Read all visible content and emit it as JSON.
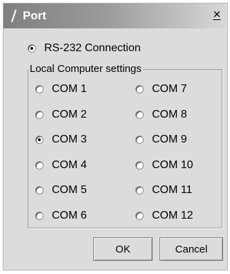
{
  "window": {
    "title": "Port",
    "close_glyph": "×"
  },
  "connection": {
    "label": "RS-232 Connection",
    "selected": true
  },
  "local_settings": {
    "group_label": "Local Computer settings",
    "selected_port": "COM 3",
    "ports_left": [
      "COM 1",
      "COM 2",
      "COM 3",
      "COM 4",
      "COM 5",
      "COM 6"
    ],
    "ports_right": [
      "COM 7",
      "COM 8",
      "COM 9",
      "COM 10",
      "COM 11",
      "COM 12"
    ]
  },
  "buttons": {
    "ok": "OK",
    "cancel": "Cancel"
  },
  "colors": {
    "dialog_bg": "#dcdcdc",
    "title_fg": "#ffffff"
  }
}
